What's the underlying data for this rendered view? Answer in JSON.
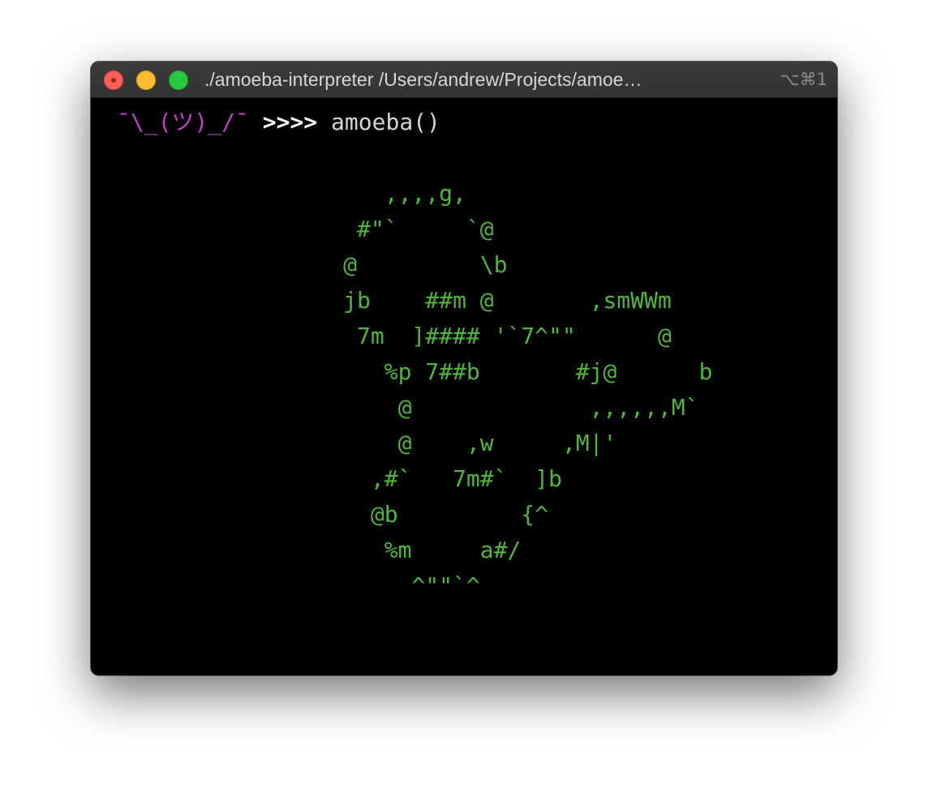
{
  "window": {
    "title": "./amoeba-interpreter /Users/andrew/Projects/amoe…",
    "shortcut": "⌥⌘1"
  },
  "terminal": {
    "prompt_shrug": "¯\\_(ツ)_/¯",
    "prompt_arrows": ">>>>",
    "command": "amoeba()",
    "ascii_art": "         ,,,,g,\n       #\"`     `@\n      @         \\b\n      jb    ##m @       ,smWWm\n       7m  ]#### '`7^\"\"      @\n         %p 7##b       #j@      b\n          @             ,,,,,,M`\n          @    ,w     ,M|'\n        ,#`   7m#`  ]b\n        @b         {^\n         %m     a#/\n           ^\"\"`^"
  },
  "colors": {
    "prompt_shrug": "#c33dc6",
    "art": "#4fb53a",
    "background": "#000000"
  }
}
